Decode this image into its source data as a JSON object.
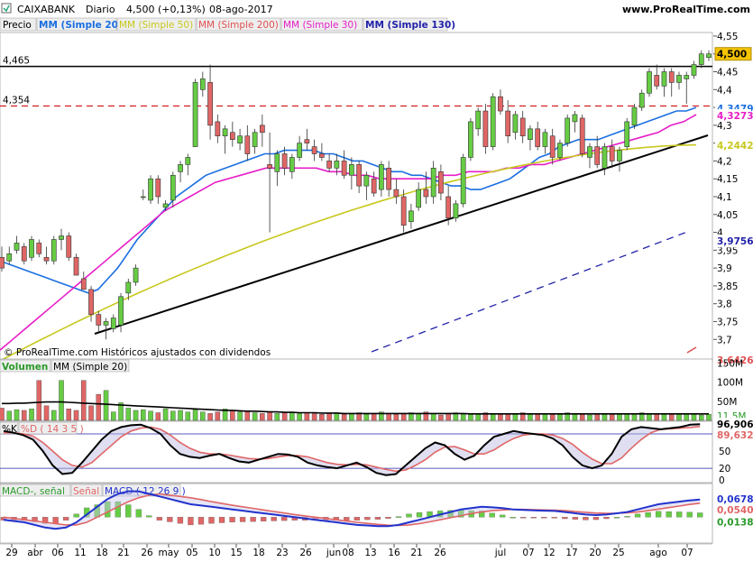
{
  "header": {
    "symbol": "CAIXABANK",
    "period": "Diario",
    "quote": "4,500 (+0,13%)",
    "date": "08-ago-2017",
    "site": "www.ProRealTime.com",
    "copyright": "© ProRealTime.com Históricos ajustados con dividendos"
  },
  "colors": {
    "up": "#66cc44",
    "down": "#e06666",
    "mm20": "#1a6fe0",
    "mm50": "#c8c81e",
    "mm200": "#e05050",
    "mm30": "#e61ec8",
    "mm130": "#2222aa",
    "macd": "#2233cc",
    "signal": "#e06666",
    "volma": "#000000",
    "hline": "#cc0000"
  },
  "legend": {
    "price": "Precio",
    "mm20": "MM (Simple 20)",
    "mm50": "MM (Simple 50)",
    "mm200": "MM (Simple 200)",
    "mm30": "MM (Simple 30)",
    "mm130": "MM (Simple 130)"
  },
  "chart_data": {
    "type": "candlestick",
    "ylim": [
      3.64,
      4.56
    ],
    "y_ticks": [
      "4,55",
      "4,5",
      "4,45",
      "4,4",
      "4,35",
      "4,3",
      "4,25",
      "4,2",
      "4,15",
      "4,1",
      "4,05",
      "4",
      "3,95",
      "3,9",
      "3,85",
      "3,8",
      "3,75",
      "3,7"
    ],
    "y_tick_values": [
      4.55,
      4.5,
      4.45,
      4.4,
      4.35,
      4.3,
      4.25,
      4.2,
      4.15,
      4.1,
      4.05,
      4.0,
      3.95,
      3.9,
      3.85,
      3.8,
      3.75,
      3.7
    ],
    "x_labels": [
      "29",
      "abr",
      "06",
      "11",
      "18",
      "21",
      "26",
      "may",
      "05",
      "10",
      "15",
      "18",
      "23",
      "26",
      "jun",
      "08",
      "13",
      "16",
      "21",
      "26",
      "jul",
      "07",
      "12",
      "17",
      "20",
      "25",
      "ago",
      "07"
    ],
    "levels": [
      {
        "label": "4,465",
        "value": 4.465,
        "style": "solid"
      },
      {
        "label": "4,354",
        "value": 4.354,
        "style": "dashed"
      }
    ],
    "right_labels": [
      {
        "text": "4,500",
        "value": 4.5,
        "color": "#000000",
        "bg": "#f5c400"
      },
      {
        "text": "4,3479",
        "value": 4.3479,
        "color": "#1a6fe0",
        "bg": "#ffffff"
      },
      {
        "text": "4,3273",
        "value": 4.3273,
        "color": "#e61ec8",
        "bg": "#ffffff"
      },
      {
        "text": "4,2442",
        "value": 4.2442,
        "color": "#c8c81e",
        "bg": "#ffffff"
      },
      {
        "text": "3,9756",
        "value": 3.9756,
        "color": "#2222aa",
        "bg": "#ffffff"
      },
      {
        "text": "3,6426",
        "value": 3.6426,
        "color": "#e05050",
        "bg": "#ffffff"
      }
    ],
    "candles": [
      [
        3.93,
        3.96,
        3.89,
        3.9
      ],
      [
        3.92,
        3.96,
        3.91,
        3.94
      ],
      [
        3.95,
        3.99,
        3.94,
        3.97
      ],
      [
        3.96,
        3.97,
        3.91,
        3.92
      ],
      [
        3.93,
        3.99,
        3.92,
        3.98
      ],
      [
        3.97,
        3.98,
        3.93,
        3.94
      ],
      [
        3.93,
        3.96,
        3.91,
        3.92
      ],
      [
        3.92,
        3.99,
        3.91,
        3.98
      ],
      [
        3.98,
        4.01,
        3.95,
        3.99
      ],
      [
        3.99,
        4.0,
        3.92,
        3.93
      ],
      [
        3.93,
        3.94,
        3.88,
        3.88
      ],
      [
        3.87,
        3.89,
        3.84,
        3.84
      ],
      [
        3.84,
        3.85,
        3.75,
        3.77
      ],
      [
        3.77,
        3.78,
        3.72,
        3.74
      ],
      [
        3.74,
        3.76,
        3.7,
        3.75
      ],
      [
        3.73,
        3.77,
        3.72,
        3.76
      ],
      [
        3.74,
        3.83,
        3.72,
        3.82
      ],
      [
        3.83,
        3.87,
        3.81,
        3.86
      ],
      [
        3.86,
        3.91,
        3.85,
        3.9
      ],
      [
        4.1,
        4.12,
        4.09,
        4.1
      ],
      [
        4.09,
        4.16,
        4.08,
        4.15
      ],
      [
        4.15,
        4.16,
        4.08,
        4.1
      ],
      [
        4.07,
        4.09,
        4.06,
        4.08
      ],
      [
        4.09,
        4.17,
        4.07,
        4.16
      ],
      [
        4.17,
        4.2,
        4.14,
        4.19
      ],
      [
        4.19,
        4.22,
        4.16,
        4.21
      ],
      [
        4.24,
        4.43,
        4.24,
        4.42
      ],
      [
        4.4,
        4.45,
        4.38,
        4.43
      ],
      [
        4.42,
        4.47,
        4.26,
        4.3
      ],
      [
        4.31,
        4.33,
        4.25,
        4.27
      ],
      [
        4.27,
        4.3,
        4.22,
        4.29
      ],
      [
        4.28,
        4.31,
        4.24,
        4.26
      ],
      [
        4.25,
        4.29,
        4.23,
        4.27
      ],
      [
        4.27,
        4.3,
        4.2,
        4.22
      ],
      [
        4.24,
        4.29,
        4.22,
        4.28
      ],
      [
        4.3,
        4.33,
        4.24,
        4.28
      ],
      [
        4.19,
        4.28,
        4.0,
        4.18
      ],
      [
        4.17,
        4.23,
        4.13,
        4.22
      ],
      [
        4.22,
        4.24,
        4.16,
        4.18
      ],
      [
        4.17,
        4.22,
        4.15,
        4.21
      ],
      [
        4.21,
        4.27,
        4.2,
        4.25
      ],
      [
        4.26,
        4.29,
        4.23,
        4.25
      ],
      [
        4.24,
        4.26,
        4.2,
        4.22
      ],
      [
        4.22,
        4.25,
        4.2,
        4.21
      ],
      [
        4.2,
        4.22,
        4.17,
        4.18
      ],
      [
        4.18,
        4.22,
        4.16,
        4.2
      ],
      [
        4.2,
        4.23,
        4.15,
        4.16
      ],
      [
        4.16,
        4.21,
        4.12,
        4.19
      ],
      [
        4.19,
        4.2,
        4.11,
        4.13
      ],
      [
        4.13,
        4.17,
        4.09,
        4.16
      ],
      [
        4.15,
        4.17,
        4.1,
        4.11
      ],
      [
        4.12,
        4.2,
        4.1,
        4.19
      ],
      [
        4.18,
        4.2,
        4.1,
        4.12
      ],
      [
        4.12,
        4.15,
        4.08,
        4.1
      ],
      [
        4.1,
        4.12,
        4.0,
        4.02
      ],
      [
        4.03,
        4.08,
        4.01,
        4.06
      ],
      [
        4.07,
        4.14,
        4.06,
        4.12
      ],
      [
        4.12,
        4.17,
        4.08,
        4.1
      ],
      [
        4.1,
        4.2,
        4.08,
        4.18
      ],
      [
        4.17,
        4.19,
        4.09,
        4.11
      ],
      [
        4.1,
        4.13,
        4.02,
        4.04
      ],
      [
        4.04,
        4.09,
        4.03,
        4.08
      ],
      [
        4.08,
        4.22,
        4.07,
        4.21
      ],
      [
        4.21,
        4.32,
        4.2,
        4.31
      ],
      [
        4.29,
        4.35,
        4.27,
        4.34
      ],
      [
        4.34,
        4.36,
        4.22,
        4.24
      ],
      [
        4.24,
        4.39,
        4.23,
        4.38
      ],
      [
        4.38,
        4.4,
        4.33,
        4.34
      ],
      [
        4.34,
        4.37,
        4.25,
        4.27
      ],
      [
        4.28,
        4.34,
        4.26,
        4.33
      ],
      [
        4.32,
        4.34,
        4.25,
        4.27
      ],
      [
        4.26,
        4.3,
        4.23,
        4.29
      ],
      [
        4.29,
        4.31,
        4.23,
        4.24
      ],
      [
        4.24,
        4.29,
        4.22,
        4.28
      ],
      [
        4.27,
        4.29,
        4.19,
        4.21
      ],
      [
        4.21,
        4.26,
        4.2,
        4.25
      ],
      [
        4.25,
        4.33,
        4.24,
        4.32
      ],
      [
        4.31,
        4.34,
        4.28,
        4.33
      ],
      [
        4.32,
        4.33,
        4.21,
        4.22
      ],
      [
        4.21,
        4.25,
        4.18,
        4.24
      ],
      [
        4.24,
        4.27,
        4.18,
        4.19
      ],
      [
        4.18,
        4.25,
        4.16,
        4.24
      ],
      [
        4.24,
        4.26,
        4.18,
        4.2
      ],
      [
        4.2,
        4.24,
        4.17,
        4.23
      ],
      [
        4.24,
        4.32,
        4.23,
        4.31
      ],
      [
        4.3,
        4.36,
        4.29,
        4.35
      ],
      [
        4.35,
        4.4,
        4.34,
        4.39
      ],
      [
        4.39,
        4.46,
        4.38,
        4.45
      ],
      [
        4.44,
        4.47,
        4.4,
        4.41
      ],
      [
        4.41,
        4.46,
        4.38,
        4.45
      ],
      [
        4.45,
        4.46,
        4.38,
        4.42
      ],
      [
        4.42,
        4.45,
        4.4,
        4.44
      ],
      [
        4.43,
        4.45,
        4.36,
        4.44
      ],
      [
        4.44,
        4.48,
        4.43,
        4.47
      ],
      [
        4.47,
        4.51,
        4.46,
        4.5
      ],
      [
        4.49,
        4.51,
        4.48,
        4.5
      ]
    ],
    "mm20": [
      3.92,
      3.91,
      3.9,
      3.89,
      3.88,
      3.87,
      3.86,
      3.85,
      3.84,
      3.83,
      3.84,
      3.87,
      3.9,
      3.94,
      3.98,
      4.01,
      4.04,
      4.07,
      4.1,
      4.12,
      4.14,
      4.16,
      4.17,
      4.18,
      4.19,
      4.2,
      4.21,
      4.22,
      4.22,
      4.23,
      4.23,
      4.23,
      4.23,
      4.22,
      4.22,
      4.21,
      4.2,
      4.2,
      4.19,
      4.18,
      4.17,
      4.17,
      4.16,
      4.16,
      4.15,
      4.14,
      4.13,
      4.13,
      4.12,
      4.12,
      4.13,
      4.14,
      4.15,
      4.17,
      4.19,
      4.21,
      4.22,
      4.24,
      4.25,
      4.26,
      4.26,
      4.26,
      4.27,
      4.28,
      4.29,
      4.3,
      4.31,
      4.32,
      4.33,
      4.34,
      4.34,
      4.35
    ],
    "mm30": [
      3.67,
      3.7,
      3.73,
      3.76,
      3.79,
      3.82,
      3.85,
      3.88,
      3.91,
      3.94,
      3.97,
      4.0,
      4.03,
      4.06,
      4.08,
      4.1,
      4.12,
      4.14,
      4.15,
      4.16,
      4.17,
      4.18,
      4.18,
      4.18,
      4.18,
      4.18,
      4.17,
      4.17,
      4.16,
      4.16,
      4.15,
      4.15,
      4.15,
      4.15,
      4.15,
      4.16,
      4.16,
      4.17,
      4.17,
      4.17,
      4.18,
      4.18,
      4.19,
      4.19,
      4.2,
      4.21,
      4.22,
      4.23,
      4.24,
      4.25,
      4.26,
      4.27,
      4.28,
      4.3,
      4.31,
      4.33
    ]
  },
  "volume": {
    "title": "Volumen",
    "ma_label": "MM (Simple 20)",
    "ticks": [
      "150M",
      "100M",
      "50M"
    ],
    "tick_values": [
      150,
      100,
      50
    ],
    "ylim": [
      0,
      160
    ],
    "last_label": "11,5M",
    "ma_last": "11,5M",
    "values": [
      32,
      24,
      28,
      26,
      30,
      104,
      38,
      26,
      104,
      30,
      26,
      104,
      38,
      68,
      78,
      22,
      46,
      32,
      26,
      28,
      24,
      20,
      30,
      24,
      26,
      22,
      28,
      22,
      18,
      22,
      30,
      26,
      22,
      24,
      20,
      18,
      22,
      18,
      20,
      22,
      18,
      20,
      18,
      16,
      18,
      20,
      16,
      18,
      20,
      16,
      18,
      22,
      18,
      16,
      18,
      20,
      18,
      22,
      18,
      14,
      18,
      20,
      16,
      18,
      16,
      20,
      18,
      16,
      18,
      18,
      20,
      18,
      16,
      18,
      16,
      18,
      20,
      16,
      18,
      14,
      16,
      18,
      16,
      18,
      16,
      18,
      20,
      18,
      16,
      18,
      18,
      16,
      18,
      16,
      14,
      16
    ],
    "ma": [
      44,
      44,
      45,
      45,
      46,
      47,
      48,
      48,
      48,
      47,
      46,
      45,
      44,
      43,
      42,
      41,
      40,
      39,
      38,
      37,
      36,
      35,
      34,
      33,
      32,
      31,
      30,
      29,
      28,
      27,
      26,
      26,
      25,
      24,
      24,
      23,
      22,
      22,
      21,
      21,
      20,
      20,
      20,
      19,
      19,
      19,
      18,
      18,
      18,
      18,
      18,
      18,
      18,
      18,
      18,
      18,
      18,
      18,
      18,
      18,
      18,
      18,
      18,
      17,
      17,
      17,
      17,
      17,
      17,
      17,
      17,
      17,
      17,
      17,
      17,
      17,
      17,
      17,
      17,
      17,
      17,
      17,
      17,
      17,
      17,
      17,
      17,
      17,
      17,
      17,
      17,
      17,
      17,
      17,
      17,
      17
    ]
  },
  "stoch": {
    "label_k": "%K",
    "label_d": "%D ( 14 3 5 )",
    "ticks": [
      "80",
      "50",
      "20",
      "0"
    ],
    "tick_values": [
      80,
      50,
      20,
      0
    ],
    "ylim": [
      -5,
      102
    ],
    "last_k": "96,906",
    "last_d": "89,632",
    "k": [
      85,
      82,
      78,
      70,
      50,
      25,
      10,
      12,
      30,
      50,
      70,
      85,
      92,
      95,
      96,
      90,
      80,
      60,
      45,
      40,
      38,
      42,
      45,
      38,
      32,
      30,
      35,
      40,
      45,
      44,
      40,
      30,
      25,
      22,
      20,
      25,
      30,
      22,
      12,
      8,
      10,
      25,
      40,
      55,
      65,
      60,
      45,
      35,
      42,
      60,
      75,
      80,
      85,
      82,
      80,
      78,
      72,
      60,
      40,
      25,
      20,
      25,
      45,
      75,
      88,
      92,
      90,
      88,
      90,
      92,
      96,
      97
    ],
    "d": [
      82,
      82,
      80,
      76,
      65,
      50,
      35,
      25,
      22,
      30,
      45,
      60,
      75,
      85,
      90,
      92,
      88,
      78,
      65,
      55,
      48,
      45,
      45,
      43,
      40,
      37,
      36,
      37,
      40,
      42,
      42,
      40,
      35,
      30,
      27,
      26,
      27,
      26,
      22,
      18,
      15,
      17,
      25,
      35,
      48,
      57,
      58,
      52,
      45,
      45,
      52,
      63,
      72,
      78,
      80,
      80,
      78,
      72,
      62,
      48,
      36,
      28,
      28,
      38,
      55,
      70,
      82,
      88,
      89,
      90,
      91,
      93
    ]
  },
  "macd": {
    "label_macd": "MACD-, señal",
    "label_signal": "Señal",
    "label_main": "MACD ( 12 26 9 )",
    "ylim": [
      -0.1,
      0.13
    ],
    "last_macd": "0,0678",
    "last_signal": "0,0540",
    "last_hist": "0,0138",
    "macd_line": [
      -0.01,
      -0.015,
      -0.02,
      -0.03,
      -0.04,
      -0.045,
      -0.04,
      -0.02,
      0.01,
      0.04,
      0.07,
      0.09,
      0.1,
      0.1,
      0.09,
      0.08,
      0.07,
      0.06,
      0.05,
      0.045,
      0.04,
      0.035,
      0.03,
      0.025,
      0.02,
      0.015,
      0.01,
      0.005,
      0.0,
      -0.005,
      -0.01,
      -0.015,
      -0.02,
      -0.025,
      -0.03,
      -0.032,
      -0.035,
      -0.035,
      -0.03,
      -0.02,
      -0.01,
      0.0,
      0.01,
      0.02,
      0.03,
      0.035,
      0.04,
      0.038,
      0.035,
      0.03,
      0.028,
      0.026,
      0.025,
      0.024,
      0.02,
      0.015,
      0.01,
      0.008,
      0.01,
      0.015,
      0.02,
      0.03,
      0.04,
      0.05,
      0.055,
      0.06,
      0.065,
      0.068
    ],
    "signal_line": [
      0.0,
      -0.005,
      -0.01,
      -0.015,
      -0.02,
      -0.025,
      -0.03,
      -0.03,
      -0.02,
      0.0,
      0.02,
      0.04,
      0.06,
      0.075,
      0.085,
      0.09,
      0.085,
      0.08,
      0.075,
      0.068,
      0.06,
      0.053,
      0.046,
      0.04,
      0.034,
      0.028,
      0.022,
      0.016,
      0.01,
      0.005,
      0.0,
      -0.005,
      -0.01,
      -0.015,
      -0.02,
      -0.024,
      -0.028,
      -0.031,
      -0.032,
      -0.03,
      -0.025,
      -0.018,
      -0.01,
      -0.002,
      0.006,
      0.014,
      0.02,
      0.025,
      0.028,
      0.03,
      0.03,
      0.029,
      0.028,
      0.027,
      0.025,
      0.022,
      0.019,
      0.016,
      0.015,
      0.015,
      0.017,
      0.02,
      0.025,
      0.031,
      0.037,
      0.043,
      0.049,
      0.054
    ]
  }
}
